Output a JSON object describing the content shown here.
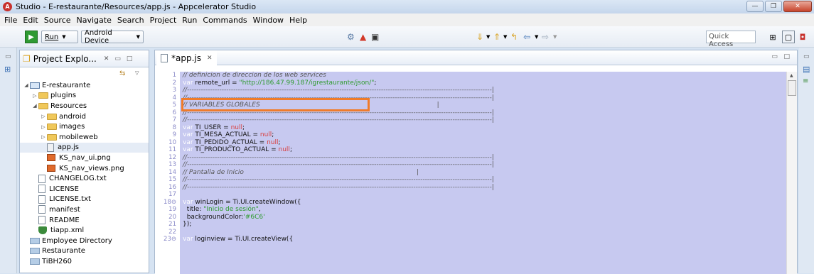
{
  "window": {
    "title": "Studio - E-restaurante/Resources/app.js - Appcelerator Studio"
  },
  "menu": [
    "File",
    "Edit",
    "Source",
    "Navigate",
    "Search",
    "Project",
    "Run",
    "Commands",
    "Window",
    "Help"
  ],
  "toolbar": {
    "run_label": "Run",
    "target_label": "Android Device",
    "quick_access": "Quick Access"
  },
  "explorer": {
    "title": "Project Explo...",
    "tree": [
      {
        "label": "E-restaurante",
        "level": 0,
        "icon": "project",
        "toggle": "open"
      },
      {
        "label": "plugins",
        "level": 1,
        "icon": "folder",
        "toggle": "closed"
      },
      {
        "label": "Resources",
        "level": 1,
        "icon": "folder",
        "toggle": "open"
      },
      {
        "label": "android",
        "level": 2,
        "icon": "folder",
        "toggle": "closed"
      },
      {
        "label": "images",
        "level": 2,
        "icon": "folder",
        "toggle": "closed"
      },
      {
        "label": "mobileweb",
        "level": 2,
        "icon": "folder",
        "toggle": "closed"
      },
      {
        "label": "app.js",
        "level": 2,
        "icon": "js",
        "toggle": ""
      },
      {
        "label": "KS_nav_ui.png",
        "level": 2,
        "icon": "png",
        "toggle": ""
      },
      {
        "label": "KS_nav_views.png",
        "level": 2,
        "icon": "png",
        "toggle": ""
      },
      {
        "label": "CHANGELOG.txt",
        "level": 1,
        "icon": "file",
        "toggle": ""
      },
      {
        "label": "LICENSE",
        "level": 1,
        "icon": "file",
        "toggle": ""
      },
      {
        "label": "LICENSE.txt",
        "level": 1,
        "icon": "file",
        "toggle": ""
      },
      {
        "label": "manifest",
        "level": 1,
        "icon": "file",
        "toggle": ""
      },
      {
        "label": "README",
        "level": 1,
        "icon": "file",
        "toggle": ""
      },
      {
        "label": "tiapp.xml",
        "level": 1,
        "icon": "xml",
        "toggle": ""
      },
      {
        "label": "Employee Directory",
        "level": 0,
        "icon": "gfolder",
        "toggle": ""
      },
      {
        "label": "Restaurante",
        "level": 0,
        "icon": "gfolder",
        "toggle": ""
      },
      {
        "label": "TiBH260",
        "level": 0,
        "icon": "gfolder",
        "toggle": ""
      }
    ]
  },
  "editor": {
    "tab_label": "*app.js",
    "lines": [
      {
        "n": "1",
        "html": "<span class='cmt'>// definicion de direccion de los web services</span>"
      },
      {
        "n": "2",
        "html": "<span class='kw'>var</span> remote_url = <span class='str'>\"http://186.47.99.187/igrestaurante/json/\"</span>;"
      },
      {
        "n": "3",
        "html": "<span class='cmt'>//------------------------------------------------------------------------------------------------------------------------------------|</span>"
      },
      {
        "n": "4",
        "html": "<span class='cmt'>//------------------------------------------------------------------------------------------------------------------------------------|</span>"
      },
      {
        "n": "5",
        "html": "<span class='cmt'>// VARIABLES GLOBALES                                                                                       |</span>"
      },
      {
        "n": "6",
        "html": "<span class='cmt'>//------------------------------------------------------------------------------------------------------------------------------------|</span>"
      },
      {
        "n": "7",
        "html": "<span class='cmt'>//------------------------------------------------------------------------------------------------------------------------------------|</span>"
      },
      {
        "n": "8",
        "html": "<span class='kw'>var</span> TI_USER = <span class='num'>null</span>;"
      },
      {
        "n": "9",
        "html": "<span class='kw'>var</span> TI_MESA_ACTUAL = <span class='num'>null</span>;"
      },
      {
        "n": "10",
        "html": "<span class='kw'>var</span> TI_PEDIDO_ACTUAL = <span class='num'>null</span>;"
      },
      {
        "n": "11",
        "html": "<span class='kw'>var</span> TI_PRODUCTO_ACTUAL = <span class='num'>null</span>;"
      },
      {
        "n": "12",
        "html": "<span class='cmt'>//------------------------------------------------------------------------------------------------------------------------------------|</span>"
      },
      {
        "n": "13",
        "html": "<span class='cmt'>//------------------------------------------------------------------------------------------------------------------------------------|</span>"
      },
      {
        "n": "14",
        "html": "<span class='cmt'>// Pantalla de Inicio                                                                                     |</span>"
      },
      {
        "n": "15",
        "html": "<span class='cmt'>//------------------------------------------------------------------------------------------------------------------------------------|</span>"
      },
      {
        "n": "16",
        "html": "<span class='cmt'>//------------------------------------------------------------------------------------------------------------------------------------|</span>"
      },
      {
        "n": "17",
        "html": ""
      },
      {
        "n": "18⊖",
        "html": "<span class='kw'>var</span> winLogin = Ti.UI.createWindow({"
      },
      {
        "n": "19",
        "html": "  title: <span class='str'>\"Inicio de sesión\"</span>,"
      },
      {
        "n": "20",
        "html": "  backgroundColor:<span class='str'>'#6C6'</span>"
      },
      {
        "n": "21",
        "html": "});"
      },
      {
        "n": "22",
        "html": ""
      },
      {
        "n": "23⊖",
        "html": "<span class='kw'>var</span> loginview = Ti.UI.createView({"
      }
    ]
  }
}
